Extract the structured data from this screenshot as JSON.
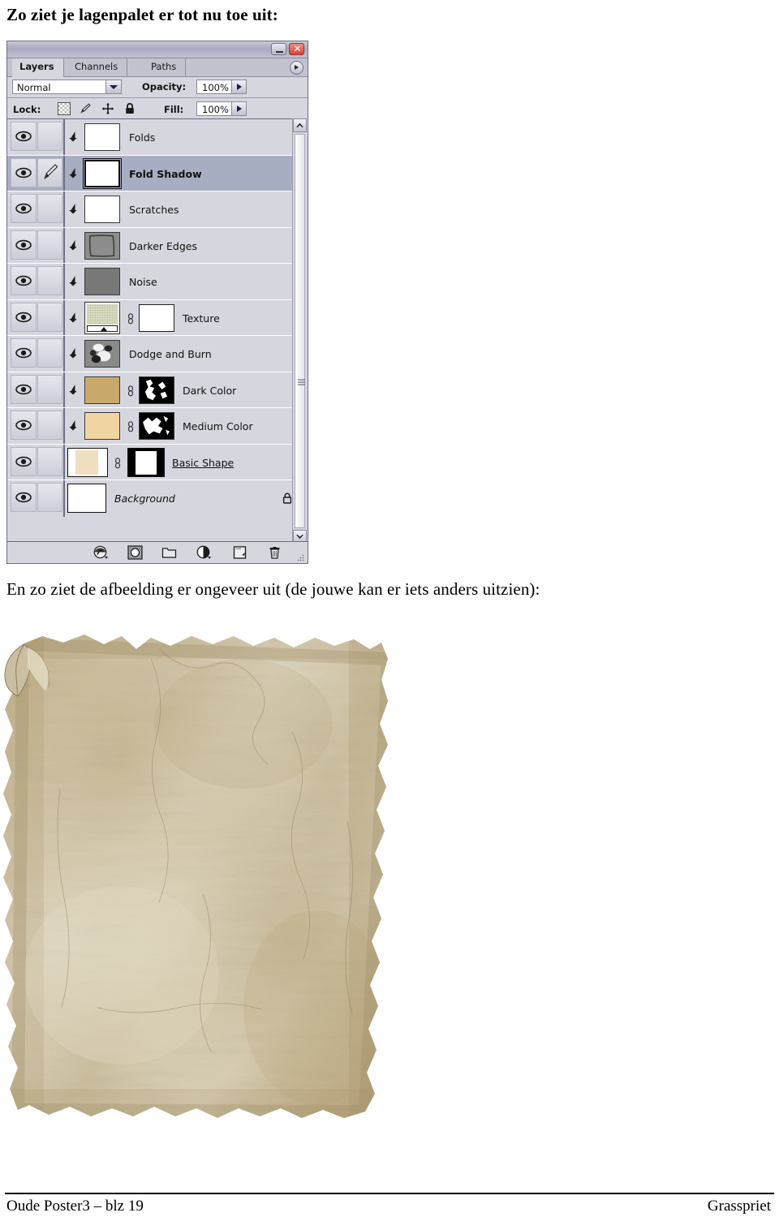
{
  "document": {
    "intro_line": "Zo ziet je lagenpalet er tot nu toe uit:",
    "mid_line": "En zo ziet de afbeelding er ongeveer uit (de jouwe kan er iets anders uitzien):",
    "footer_left": "Oude Poster3 – blz 19",
    "footer_right": "Grasspriet"
  },
  "layers_palette": {
    "window_buttons": {
      "minimize": "–",
      "close": "✕"
    },
    "tabs": [
      {
        "label": "Layers",
        "active": true
      },
      {
        "label": "Channels",
        "active": false
      },
      {
        "label": "Paths",
        "active": false
      }
    ],
    "panel_menu_icon": "panel-menu-icon",
    "blend_mode": {
      "value": "Normal",
      "icon": "chevron-down-icon"
    },
    "opacity": {
      "label": "Opacity:",
      "value": "100%",
      "stepper_icon": "stepper-arrow-icon"
    },
    "fill": {
      "label": "Fill:",
      "value": "100%",
      "stepper_icon": "stepper-arrow-icon"
    },
    "lock": {
      "label": "Lock:",
      "items": [
        {
          "name": "lock-transparent-pixels",
          "icon": "checkerboard-icon"
        },
        {
          "name": "lock-image-pixels",
          "icon": "brush-icon"
        },
        {
          "name": "lock-position",
          "icon": "move-cross-icon"
        },
        {
          "name": "lock-all",
          "icon": "padlock-icon"
        }
      ]
    },
    "layers": [
      {
        "name": "Folds",
        "thumb": "transparent",
        "mask": null,
        "selected": false,
        "style": "normal",
        "clipped": true,
        "painting": false,
        "locked": false
      },
      {
        "name": "Fold Shadow",
        "thumb": "transparent",
        "mask": null,
        "selected": true,
        "style": "bold",
        "clipped": true,
        "painting": true,
        "locked": false
      },
      {
        "name": "Scratches",
        "thumb": "transparent",
        "mask": null,
        "selected": false,
        "style": "normal",
        "clipped": true,
        "painting": false,
        "locked": false
      },
      {
        "name": "Darker Edges",
        "thumb": "gray-edges",
        "mask": null,
        "selected": false,
        "style": "normal",
        "clipped": true,
        "painting": false,
        "locked": false
      },
      {
        "name": "Noise",
        "thumb": "gray-solid",
        "mask": null,
        "selected": false,
        "style": "normal",
        "clipped": true,
        "painting": false,
        "locked": false
      },
      {
        "name": "Texture",
        "thumb": "pattern-fill",
        "mask": "white",
        "selected": false,
        "style": "normal",
        "clipped": true,
        "painting": false,
        "locked": false
      },
      {
        "name": "Dodge and Burn",
        "thumb": "dodge-burn",
        "mask": null,
        "selected": false,
        "style": "normal",
        "clipped": true,
        "painting": false,
        "locked": false
      },
      {
        "name": "Dark Color",
        "thumb": "color-dark",
        "mask": "black-white",
        "selected": false,
        "style": "normal",
        "clipped": true,
        "painting": false,
        "locked": false
      },
      {
        "name": "Medium Color",
        "thumb": "color-medium",
        "mask": "black-white",
        "selected": false,
        "style": "normal",
        "clipped": true,
        "painting": false,
        "locked": false
      },
      {
        "name": "Basic Shape",
        "thumb": "shape-beige",
        "mask": "shape-mask",
        "selected": false,
        "style": "underline",
        "clipped": false,
        "painting": false,
        "locked": false
      },
      {
        "name": "Background",
        "thumb": "white",
        "mask": null,
        "selected": false,
        "style": "italic",
        "clipped": false,
        "painting": false,
        "locked": true
      }
    ],
    "colors": {
      "panel_background": "#d6d6de",
      "selected_row": "#a8aec2",
      "dark_color_swatch": "#c9a96b",
      "medium_color_swatch": "#f0d5a3",
      "basic_shape_swatch": "#f0dfc0",
      "noise_swatch": "#787878",
      "close_button": "#d24a38"
    },
    "scrollbar": {
      "up_icon": "chevron-up-icon",
      "down_icon": "chevron-down-icon",
      "grip_icon": "scrollbar-grip-icon"
    },
    "toolbar": [
      {
        "name": "layer-style",
        "icon": "fx-circle-icon"
      },
      {
        "name": "add-layer-mask",
        "icon": "mask-circle-icon"
      },
      {
        "name": "new-group",
        "icon": "folder-icon"
      },
      {
        "name": "new-adjustment-layer",
        "icon": "half-circle-icon"
      },
      {
        "name": "new-layer",
        "icon": "new-layer-icon"
      },
      {
        "name": "delete-layer",
        "icon": "trash-icon"
      }
    ]
  },
  "figure": {
    "alt": "Aged parchment poster with torn deckled edges and curled top-left corner",
    "colors": {
      "paper_light": "#ded3b8",
      "paper_mid": "#cbb993",
      "paper_dark": "#b09f74",
      "edge_shadow": "#9c8a63"
    }
  }
}
